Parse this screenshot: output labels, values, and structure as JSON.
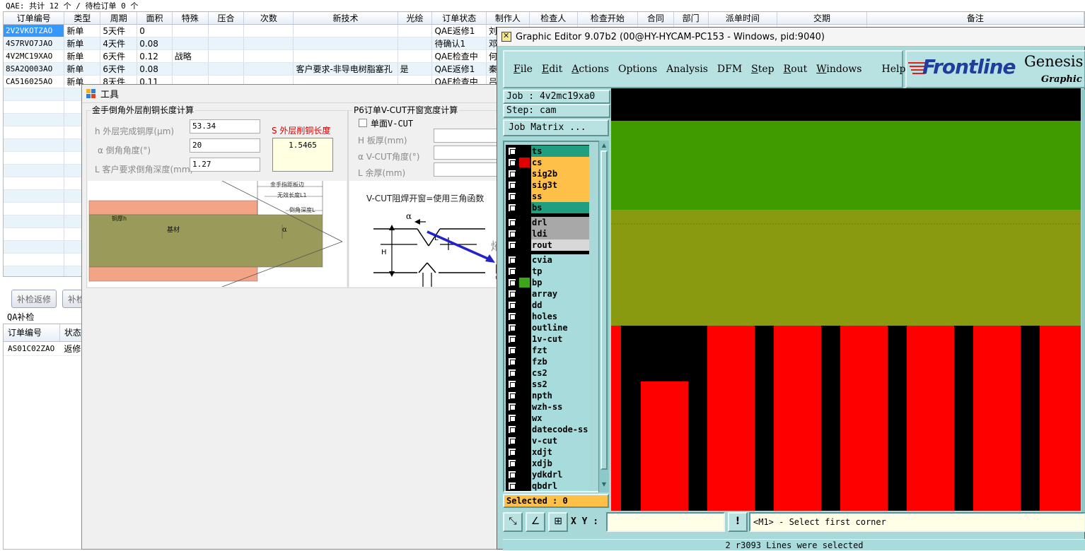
{
  "background": {
    "summary": "QAE: 共计 12 个 / 待检订单 0 个",
    "columns": [
      "订单编号",
      "类型",
      "周期",
      "面积",
      "特殊",
      "压合",
      "次数",
      "新技术",
      "光绘",
      "订单状态",
      "制作人",
      "检查人",
      "检查开始",
      "合同",
      "部门",
      "派单时间",
      "交期",
      "备注"
    ],
    "rows": [
      [
        "2V2VKOTZAO",
        "新单",
        "5天件",
        "0",
        "",
        "",
        "",
        "",
        "",
        "QAE返修1",
        "刘"
      ],
      [
        "4S7RVO7JAO",
        "新单",
        "4天件",
        "0.08",
        "",
        "",
        "",
        "",
        "",
        "待确认1",
        "邓"
      ],
      [
        "4V2MC19XAO",
        "新单",
        "6天件",
        "0.12",
        "战略",
        "",
        "",
        "",
        "",
        "QAE检查中",
        "何"
      ],
      [
        "8SA2Q003AO",
        "新单",
        "6天件",
        "0.08",
        "",
        "",
        "",
        "客户要求-非导电树脂塞孔",
        "是",
        "QAE返修1",
        "秦"
      ],
      [
        "CA516025AO",
        "新单",
        "8天件",
        "0.11",
        "",
        "",
        "",
        "",
        "",
        "QAE检查中",
        "吕"
      ]
    ],
    "buttons": [
      "补检返修",
      "补检"
    ],
    "qa_label": "QA补检",
    "qa_columns": [
      "订单编号",
      "状态"
    ],
    "qa_rows": [
      [
        "AS01C02ZAO",
        "返修"
      ]
    ]
  },
  "tool": {
    "title": "工具",
    "group1_title": "金手倒角外层削铜长度计算",
    "field_h_label": "h 外层完成铜厚(μm)",
    "field_h_value": "53.34",
    "field_alpha_label": "α 倒角角度(°)",
    "field_alpha_value": "20",
    "field_L_label": "L 客户要求倒角深度(mm)",
    "field_L_value": "1.27",
    "result_label": "S 外层削铜长度",
    "result_value": "1.5465",
    "diagram1": {
      "label_edge": "金手指距板边",
      "label_invalid": "无效长度L1",
      "label_depth": "倒角深度L",
      "label_cu": "铜厚h",
      "label_base": "基材",
      "label_alpha": "α"
    },
    "group2_title": "P6订单V-CUT开窗宽度计算",
    "single_vcut": "单面V-CUT",
    "field_H_label": "H 板厚(mm)",
    "field_vcut_angle_label": "α V-CUT角度(°)",
    "field_rest_label": "L 余厚(mm)",
    "formula_text": "V-CUT阻焊开窗=使用三角函数",
    "diagram2": {
      "label_alpha": "α",
      "label_L": "L",
      "label_H": "H",
      "label_red1": "阻",
      "label_red2": "窗",
      "label_gray": "焲"
    }
  },
  "genesis": {
    "title": "Graphic Editor 9.07b2 (00@HY-HYCAM-PC153 - Windows, pid:9040)",
    "menu": [
      "File",
      "Edit",
      "Actions",
      "Options",
      "Analysis",
      "DFM",
      "Step",
      "Rout",
      "Windows",
      "Help"
    ],
    "logo_text": "Frontline",
    "logo_genesis": "Genesis",
    "logo_sub": "Graphic Ed",
    "job": "Job : 4v2mc19xa0",
    "step": "Step: cam",
    "job_matrix": "Job Matrix ...",
    "layers": [
      {
        "name": "ts",
        "color": "#1f9f80",
        "swatch": "#000000"
      },
      {
        "name": "cs",
        "color": "#ffc04a",
        "swatch": "#e00000"
      },
      {
        "name": "sig2b",
        "color": "#ffc04a",
        "swatch": "#000000"
      },
      {
        "name": "sig3t",
        "color": "#ffc04a",
        "swatch": "#000000"
      },
      {
        "name": "ss",
        "color": "#ffc04a",
        "swatch": "#000000"
      },
      {
        "name": "bs",
        "color": "#1f9f80",
        "swatch": "#000000"
      },
      {
        "name": "drl",
        "color": "#a8a8a8",
        "swatch": "#000000"
      },
      {
        "name": "ldi",
        "color": "#a8a8a8",
        "swatch": "#000000"
      },
      {
        "name": "rout",
        "color": "#d8d8d8",
        "swatch": "#000000"
      },
      {
        "name": "cvia",
        "color": "#a8dcdc",
        "swatch": "#000000"
      },
      {
        "name": "tp",
        "color": "#a8dcdc",
        "swatch": "#000000"
      },
      {
        "name": "bp",
        "color": "#a8dcdc",
        "swatch": "#3da51a"
      },
      {
        "name": "array",
        "color": "#a8dcdc",
        "swatch": "#000000"
      },
      {
        "name": "dd",
        "color": "#a8dcdc",
        "swatch": "#000000"
      },
      {
        "name": "holes",
        "color": "#a8dcdc",
        "swatch": "#000000"
      },
      {
        "name": "outline",
        "color": "#a8dcdc",
        "swatch": "#000000"
      },
      {
        "name": "1v-cut",
        "color": "#a8dcdc",
        "swatch": "#000000"
      },
      {
        "name": "fzt",
        "color": "#a8dcdc",
        "swatch": "#000000"
      },
      {
        "name": "fzb",
        "color": "#a8dcdc",
        "swatch": "#000000"
      },
      {
        "name": "cs2",
        "color": "#a8dcdc",
        "swatch": "#000000"
      },
      {
        "name": "ss2",
        "color": "#a8dcdc",
        "swatch": "#000000"
      },
      {
        "name": "npth",
        "color": "#a8dcdc",
        "swatch": "#000000"
      },
      {
        "name": "wzh-ss",
        "color": "#a8dcdc",
        "swatch": "#000000"
      },
      {
        "name": "wx",
        "color": "#a8dcdc",
        "swatch": "#000000"
      },
      {
        "name": "datecode-ss",
        "color": "#a8dcdc",
        "swatch": "#000000"
      },
      {
        "name": "v-cut",
        "color": "#a8dcdc",
        "swatch": "#000000"
      },
      {
        "name": "xdjt",
        "color": "#a8dcdc",
        "swatch": "#000000"
      },
      {
        "name": "xdjb",
        "color": "#a8dcdc",
        "swatch": "#000000"
      },
      {
        "name": "ydkdrl",
        "color": "#a8dcdc",
        "swatch": "#000000"
      },
      {
        "name": "qbdrl",
        "color": "#a8dcdc",
        "swatch": "#000000"
      }
    ],
    "selected": "Selected : 0",
    "xy_label": "X Y :",
    "xy_value": "",
    "prompt": "<M1> - Select first corner",
    "message": "2 r3093 Lines were selected",
    "colors": {
      "green": "#3f9b00",
      "olive": "#8a9a10",
      "red": "#ff0000",
      "black": "#000000"
    }
  }
}
